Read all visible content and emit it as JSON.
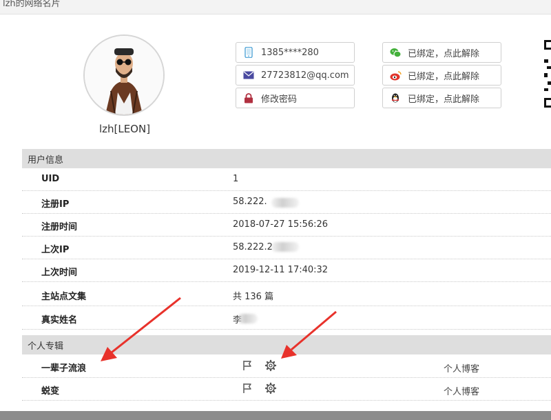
{
  "window": {
    "title": "lzh的网络名片"
  },
  "profile": {
    "username": "lzh[LEON]"
  },
  "contact": {
    "phone": "1385****280",
    "email": "27723812@qq.com",
    "password_label": "修改密码"
  },
  "bindings": {
    "wechat": "已绑定，点此解除",
    "weibo": "已绑定，点此解除",
    "qq": "已绑定，点此解除"
  },
  "user_info": {
    "section_title": "用户信息",
    "rows": [
      {
        "label": "UID",
        "value": "1"
      },
      {
        "label": "注册IP",
        "value": "58.222."
      },
      {
        "label": "注册时间",
        "value": "2018-07-27 15:56:26"
      },
      {
        "label": "上次IP",
        "value": "58.222.2"
      },
      {
        "label": "上次时间",
        "value": "2019-12-11 17:40:32"
      },
      {
        "label": "主站点文集",
        "value": "共 136 篇"
      },
      {
        "label": "真实姓名",
        "value": "李"
      }
    ]
  },
  "columns": {
    "section_title": "个人专辑",
    "rows": [
      {
        "name": "一辈子流浪",
        "type": "个人博客"
      },
      {
        "name": "蜕变",
        "type": "个人博客"
      }
    ]
  },
  "icons": {
    "phone": "phone-icon",
    "email": "envelope-icon",
    "password": "lock-icon",
    "wechat": "wechat-icon",
    "weibo": "weibo-icon",
    "qq": "qq-penguin-icon",
    "flag": "flag-icon",
    "settings": "gear-icon"
  },
  "colors": {
    "phone_icon": "#5aa9d9",
    "email_icon": "#4a4aa0",
    "lock_icon": "#b03040",
    "wechat_icon": "#44b03b",
    "weibo_icon": "#e0352b",
    "section_bg": "#dedede",
    "annotation_arrow": "#e8322b"
  }
}
